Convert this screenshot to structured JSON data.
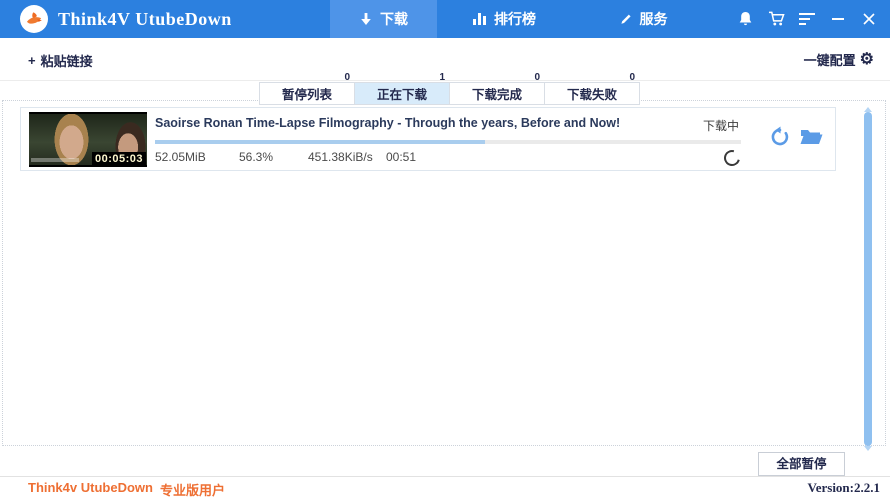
{
  "colors": {
    "titlebar_blue": "#2c80df",
    "active_nav_blue": "#4e94e8",
    "active_tab_bg": "#d8ebfa",
    "progress_fill": "#a9cdee",
    "progress_track": "#eaeaea",
    "scrollbar_thumb": "#8fc0f0",
    "action_icon_blue": "#5b9be6",
    "brand_orange": "#ee6f33",
    "text_navy": "#23294d"
  },
  "icons": {
    "plus": "+",
    "gear": "⚙"
  },
  "titlebar": {
    "app_title": "Think4V UtubeDown",
    "nav": [
      {
        "label": "下载"
      },
      {
        "label": "排行榜"
      },
      {
        "label": "服务"
      }
    ]
  },
  "toolbar": {
    "paste_link_label": "粘贴链接",
    "quick_config_label": "一键配置"
  },
  "filter_tabs": [
    {
      "label": "暂停列表",
      "count": "0"
    },
    {
      "label": "正在下载",
      "count": "1"
    },
    {
      "label": "下载完成",
      "count": "0"
    },
    {
      "label": "下载失败",
      "count": "0"
    }
  ],
  "download_item": {
    "title": "Saoirse Ronan Time-Lapse Filmography - Through the years, Before and Now!",
    "status": "下载中",
    "size": "52.05MiB",
    "percent": "56.3%",
    "percent_value": 56.3,
    "speed": "451.38KiB/s",
    "time_remaining": "00:51",
    "thumbnail_duration": "00:05:03"
  },
  "footer": {
    "pause_all_label": "全部暂停",
    "brand": "Think4v UtubeDown",
    "user_label": "专业版用户",
    "version": "Version:2.2.1"
  }
}
